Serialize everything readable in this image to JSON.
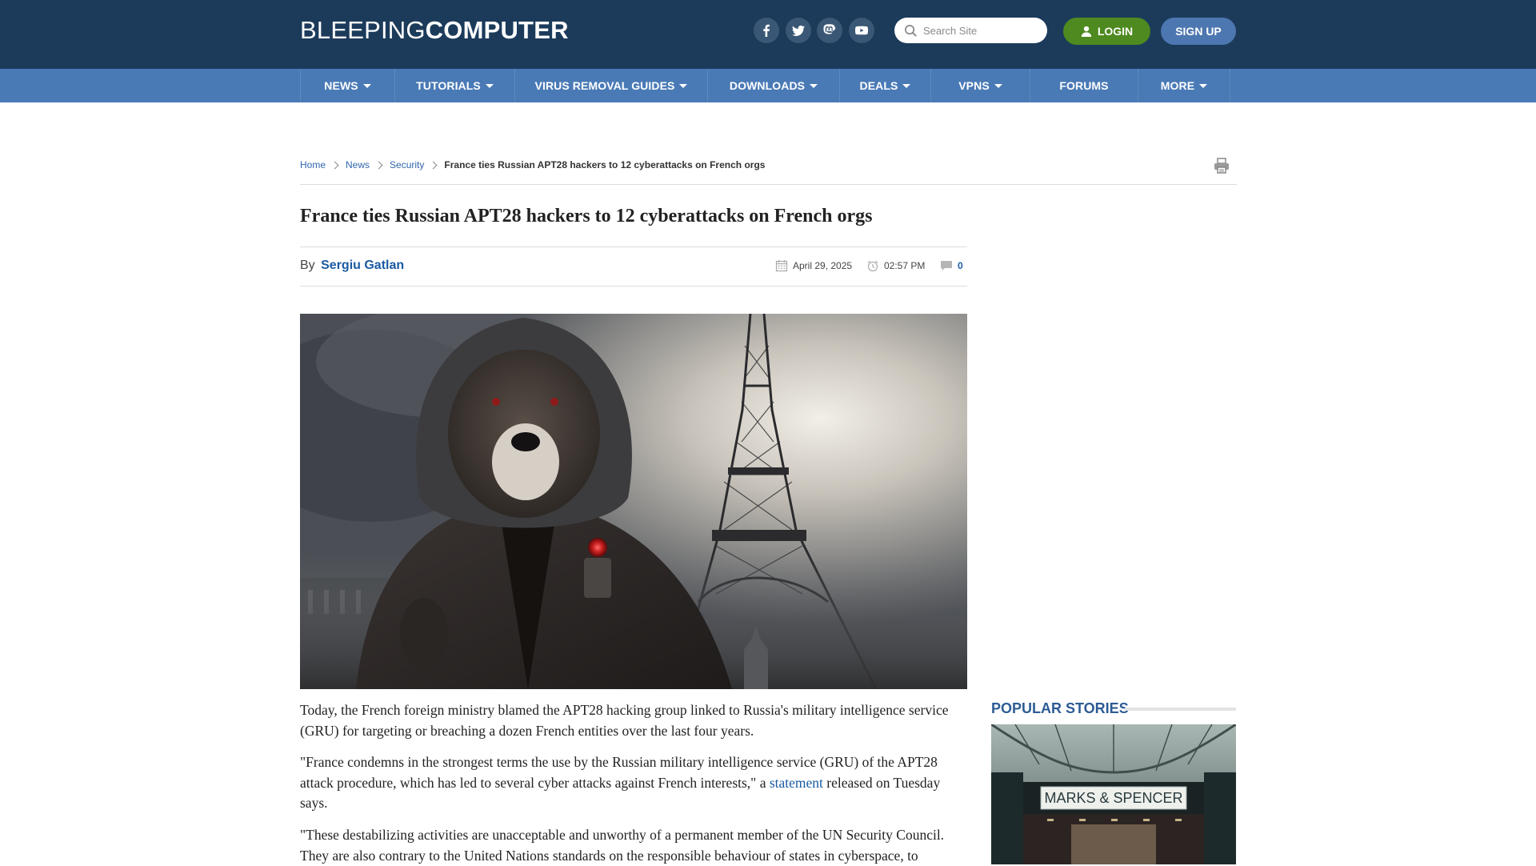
{
  "header": {
    "logo_light": "BLEEPING",
    "logo_bold": "COMPUTER",
    "social": [
      "facebook-icon",
      "twitter-icon",
      "mastodon-icon",
      "youtube-icon"
    ],
    "search_placeholder": "Search Site",
    "login_label": "LOGIN",
    "signup_label": "SIGN UP"
  },
  "nav": {
    "items": [
      {
        "label": "NEWS",
        "dropdown": true
      },
      {
        "label": "TUTORIALS",
        "dropdown": true
      },
      {
        "label": "VIRUS REMOVAL GUIDES",
        "dropdown": true
      },
      {
        "label": "DOWNLOADS",
        "dropdown": true
      },
      {
        "label": "DEALS",
        "dropdown": true
      },
      {
        "label": "VPNS",
        "dropdown": true
      },
      {
        "label": "FORUMS",
        "dropdown": false
      },
      {
        "label": "MORE",
        "dropdown": true
      }
    ]
  },
  "breadcrumb": {
    "items": [
      "Home",
      "News",
      "Security"
    ],
    "current": "France ties Russian APT28 hackers to 12 cyberattacks on French orgs"
  },
  "article": {
    "title": "France ties Russian APT28 hackers to 12 cyberattacks on French orgs",
    "by_label": "By",
    "author": "Sergiu Gatlan",
    "date": "April 29, 2025",
    "time": "02:57 PM",
    "comments": "0",
    "hero_alt": "Hooded bear in front of the Eiffel Tower",
    "paragraphs": {
      "p1": "Today, the French foreign ministry blamed the APT28 hacking group linked to Russia's military intelligence service (GRU) for targeting or breaching a dozen French entities over the last four years.",
      "p2_before": "\"France condemns in the strongest terms the use by the Russian military intelligence service (GRU) of the APT28 attack procedure, which has led to several cyber attacks against French interests,\" a ",
      "p2_link": "statement",
      "p2_after": " released on Tuesday says.",
      "p3": "\"These destabilizing activities are unacceptable and unworthy of a permanent member of the UN Security Council. They are also contrary to the United Nations standards on the responsible behaviour of states in cyberspace, to"
    }
  },
  "sidebar": {
    "popular_heading": "POPULAR STORIES",
    "story_image_text": "MARKS & SPENCER"
  },
  "colors": {
    "header_bg": "#1c3b5b",
    "nav_bg": "#4a7ab6",
    "login_bg": "#4e8a1f",
    "signup_bg": "#4d77b0",
    "link": "#1b5ba3"
  }
}
